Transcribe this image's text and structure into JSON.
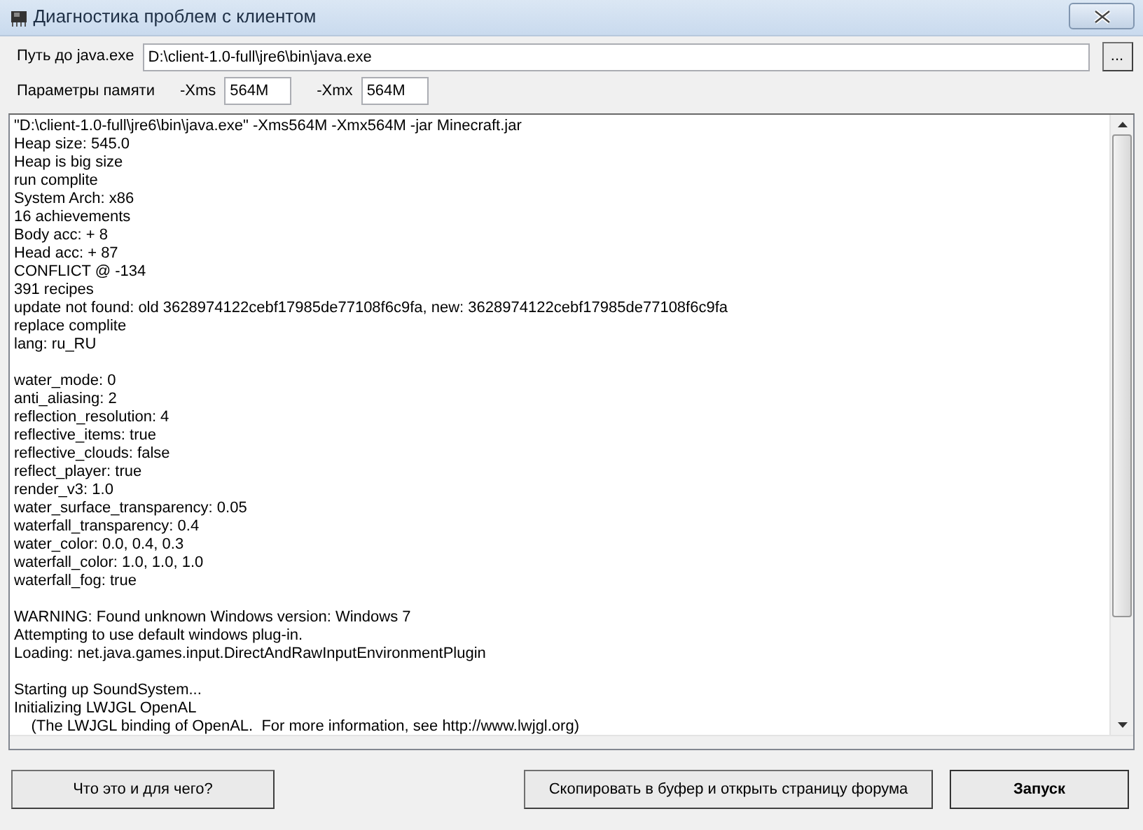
{
  "window": {
    "title": "Диагностика проблем с клиентом"
  },
  "java_path": {
    "label": "Путь до java.exe",
    "value": "D:\\client-1.0-full\\jre6\\bin\\java.exe",
    "browse_button": "..."
  },
  "memory": {
    "label": "Параметры памяти",
    "fields": [
      {
        "label": "-Xms",
        "value": "564M"
      },
      {
        "label": "-Xmx",
        "value": "564M"
      }
    ]
  },
  "log": [
    {
      "lines": [
        "\"D:\\client-1.0-full\\jre6\\bin\\java.exe\" -Xms564M -Xmx564M -jar Minecraft.jar",
        "Heap size: 545.0",
        "Heap is big size",
        "run complite",
        "System Arch: x86",
        "16 achievements",
        "Body acc: + 8",
        "Head acc: + 87",
        "CONFLICT @ -134",
        "391 recipes",
        "update not found: old 3628974122cebf17985de77108f6c9fa, new: 3628974122cebf17985de77108f6c9fa",
        "replace complite",
        "lang: ru_RU"
      ]
    },
    {
      "lines": [
        "water_mode: 0",
        "anti_aliasing: 2",
        "reflection_resolution: 4",
        "reflective_items: true",
        "reflective_clouds: false",
        "reflect_player: true",
        "render_v3: 1.0",
        "water_surface_transparency: 0.05",
        "waterfall_transparency: 0.4",
        "water_color: 0.0, 0.4, 0.3",
        "waterfall_color: 1.0, 1.0, 1.0",
        "waterfall_fog: true"
      ]
    },
    {
      "lines": [
        "WARNING: Found unknown Windows version: Windows 7",
        "Attempting to use default windows plug-in.",
        "Loading: net.java.games.input.DirectAndRawInputEnvironmentPlugin"
      ]
    },
    {
      "lines": [
        "Starting up SoundSystem...",
        "Initializing LWJGL OpenAL",
        "    (The LWJGL binding of OpenAL.  For more information, see http://www.lwjgl.org)"
      ]
    }
  ],
  "buttons": [
    {
      "label": "Что это и для чего?",
      "kind": "normal"
    },
    {
      "label": "Скопировать в буфер и открыть страницу форума",
      "kind": "normal"
    },
    {
      "label": "Запуск",
      "kind": "default"
    }
  ]
}
